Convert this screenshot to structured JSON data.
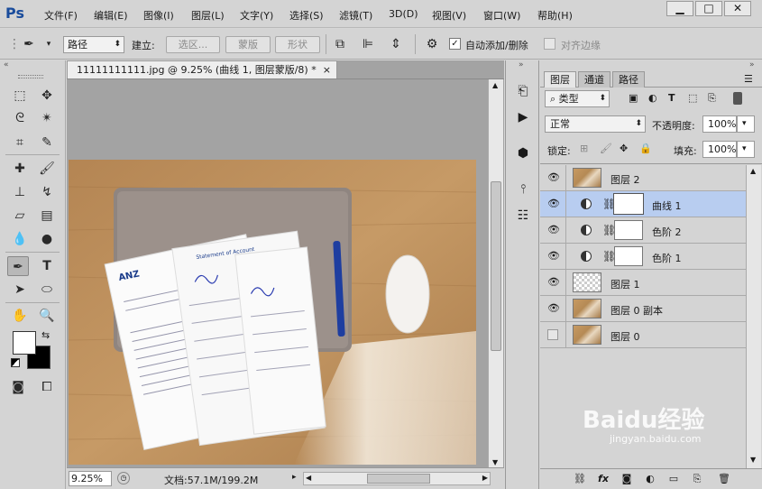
{
  "app": {
    "logo": "Ps"
  },
  "menubar": {
    "items": [
      "文件(F)",
      "编辑(E)",
      "图像(I)",
      "图层(L)",
      "文字(Y)",
      "选择(S)",
      "滤镜(T)",
      "3D(D)",
      "视图(V)",
      "窗口(W)",
      "帮助(H)"
    ],
    "window_buttons": {
      "minimize": "▁",
      "maximize": "□",
      "close": "✕"
    }
  },
  "options": {
    "tool_icon": "pen-icon",
    "mode": "路径",
    "build_label": "建立:",
    "selection_btn": "选区...",
    "mask_btn": "蒙版",
    "shape_btn": "形状",
    "auto_add_label": "自动添加/删除",
    "auto_add_checked": true,
    "align_edges_label": "对齐边缘",
    "align_edges_checked": false
  },
  "document": {
    "tab_title": "11111111111.jpg @ 9.25% (曲线 1, 图层蒙版/8) *",
    "zoom": "9.25%",
    "doc_info": "文档:57.1M/199.2M"
  },
  "layers_panel": {
    "tabs": [
      "图层",
      "通道",
      "路径"
    ],
    "filter_label": "类型",
    "blend_mode": "正常",
    "opacity_label": "不透明度:",
    "opacity_value": "100%",
    "lock_label": "锁定:",
    "fill_label": "填充:",
    "fill_value": "100%",
    "layers": [
      {
        "name": "图层 2",
        "visible": true,
        "type": "photo",
        "selected": false
      },
      {
        "name": "曲线 1",
        "visible": true,
        "type": "adjustment",
        "selected": true
      },
      {
        "name": "色阶 2",
        "visible": true,
        "type": "adjustment",
        "selected": false
      },
      {
        "name": "色阶 1",
        "visible": true,
        "type": "adjustment",
        "selected": false
      },
      {
        "name": "图层 1",
        "visible": true,
        "type": "transparent",
        "selected": false
      },
      {
        "name": "图层 0 副本",
        "visible": true,
        "type": "photo",
        "selected": false
      },
      {
        "name": "图层 0",
        "visible": false,
        "type": "photo",
        "selected": false
      }
    ]
  },
  "watermark": {
    "text": "Baidu经验",
    "sub": "jingyan.baidu.com"
  },
  "photo": {
    "header_left": "ANZ",
    "statement_title": "Statement of Account"
  }
}
